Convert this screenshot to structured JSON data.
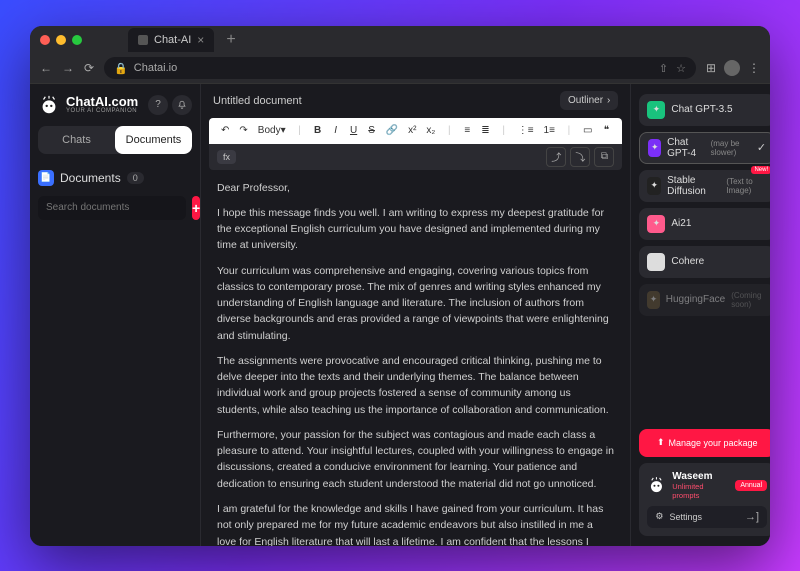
{
  "browser": {
    "tab_title": "Chat-AI",
    "url": "Chatai.io",
    "new_tab": "+"
  },
  "brand": {
    "name": "ChatAI.com",
    "tagline": "YOUR AI COMPANION"
  },
  "sidebar": {
    "tabs": {
      "chats": "Chats",
      "documents": "Documents"
    },
    "section_label": "Documents",
    "count": "0",
    "search_placeholder": "Search documents"
  },
  "doc": {
    "title": "Untitled document",
    "outliner": "Outliner",
    "body_select": "Body",
    "md_badge": "fx",
    "paragraphs": [
      "Dear Professor,",
      "I hope this message finds you well. I am writing to express my deepest gratitude for the exceptional English curriculum you have designed and implemented during my time at university.",
      "Your curriculum was comprehensive and engaging, covering various topics from classics to contemporary prose. The mix of genres and writing styles enhanced my understanding of English language and literature. The inclusion of authors from diverse backgrounds and eras provided a range of viewpoints that were enlightening and stimulating.",
      "The assignments were provocative and encouraged critical thinking, pushing me to delve deeper into the texts and their underlying themes. The balance between individual work and group projects fostered a sense of community among us students, while also teaching us the importance of collaboration and communication.",
      "Furthermore, your passion for the subject was contagious and made each class a pleasure to attend. Your insightful lectures, coupled with your willingness to engage in discussions, created a conducive environment for learning. Your patience and dedication to ensuring each student understood the material did not go unnoticed.",
      "I am grateful for the knowledge and skills I have gained from your curriculum. It has not only prepared me for my future academic endeavors but also instilled in me a love for English literature that will last a lifetime. I am confident that the lessons I have learned in your class will be useful in my future career and personal life."
    ]
  },
  "models": [
    {
      "name": "Chat GPT-3.5",
      "hint": "",
      "icon_bg": "#19c37d",
      "selected": false,
      "badge": ""
    },
    {
      "name": "Chat GPT-4",
      "hint": "(may be slower)",
      "icon_bg": "#7b2ff7",
      "selected": true,
      "badge": ""
    },
    {
      "name": "Stable Diffusion",
      "hint": "(Text to Image)",
      "icon_bg": "#222",
      "selected": false,
      "badge": "New!"
    },
    {
      "name": "Ai21",
      "hint": "",
      "icon_bg": "#ff5a8c",
      "selected": false,
      "badge": ""
    },
    {
      "name": "Cohere",
      "hint": "",
      "icon_bg": "#ddd",
      "selected": false,
      "badge": ""
    },
    {
      "name": "HuggingFace",
      "hint": "(Coming soon)",
      "icon_bg": "#6b5b3e",
      "selected": false,
      "badge": ""
    }
  ],
  "package": {
    "manage": "Manage your package"
  },
  "user": {
    "name": "Waseem",
    "sub": "Unlimited prompts",
    "plan": "Annual",
    "settings": "Settings"
  }
}
